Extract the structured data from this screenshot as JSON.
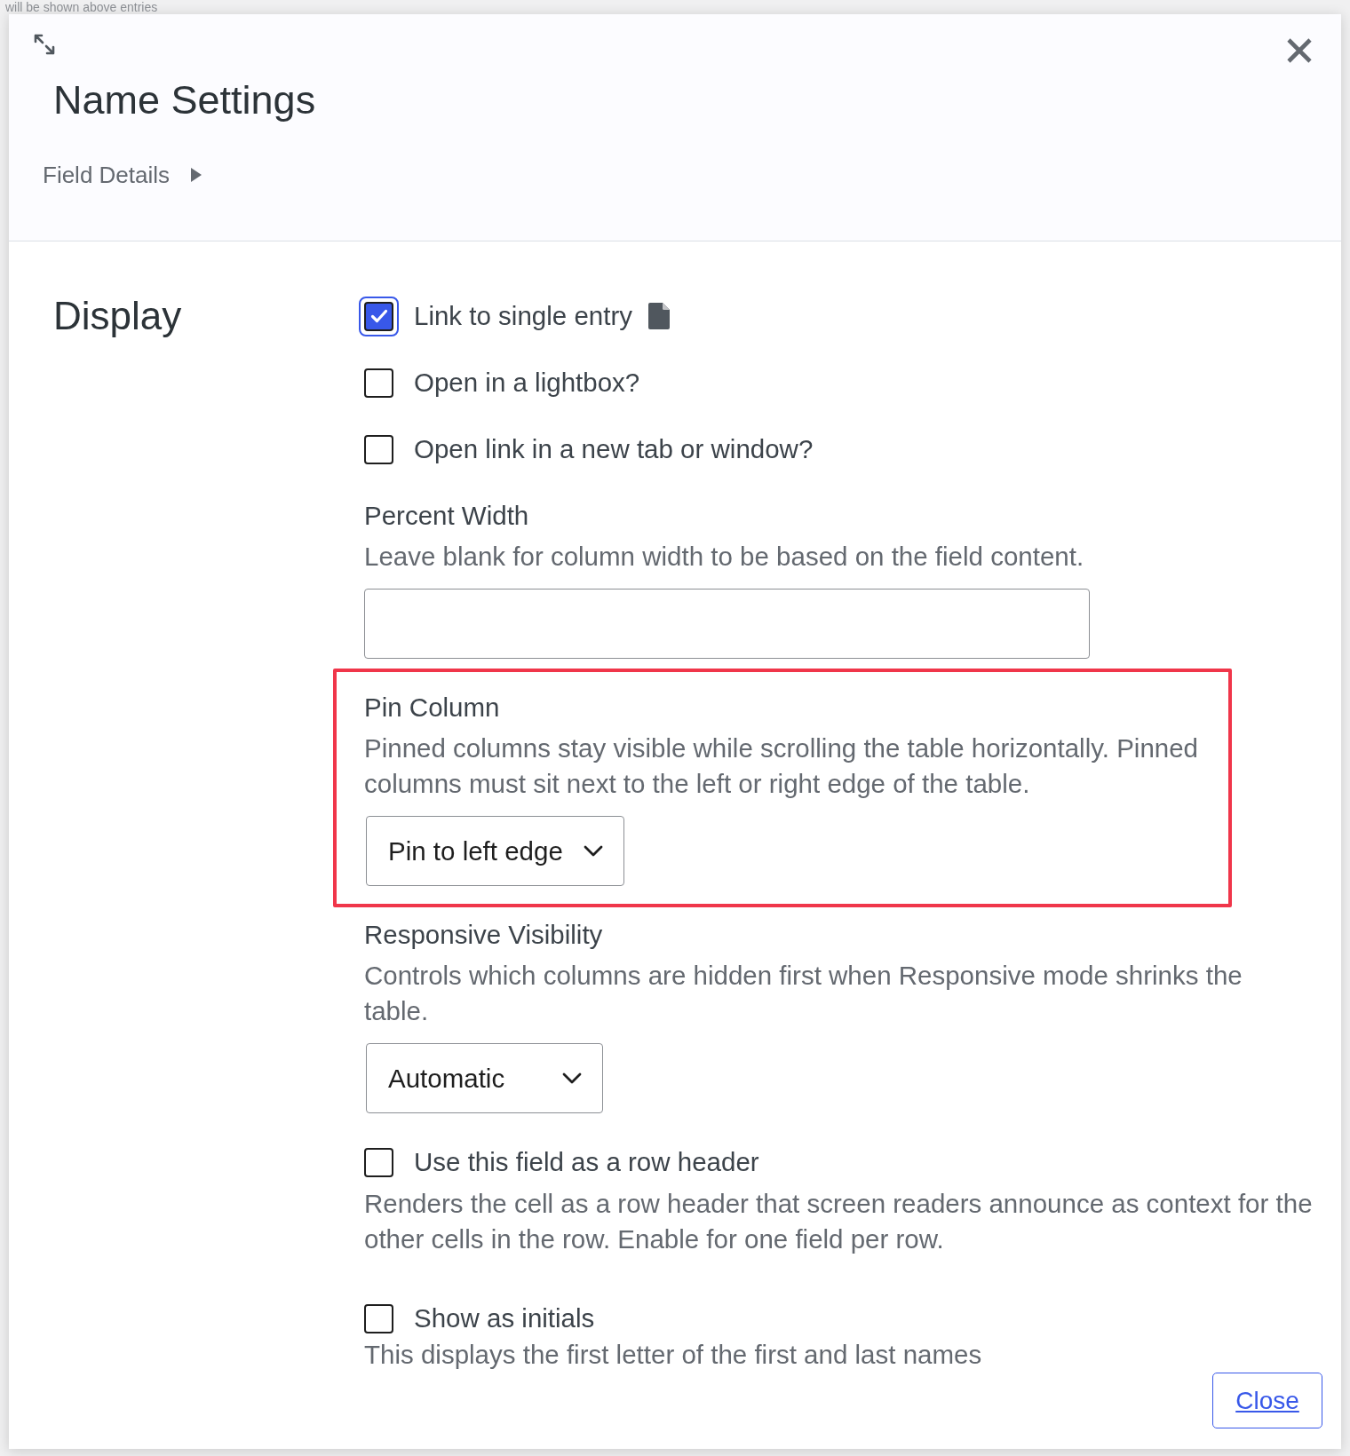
{
  "backdrop": {
    "text": "will be shown above entries"
  },
  "dialog": {
    "title": "Name Settings",
    "details_toggle": {
      "label": "Field Details",
      "expanded": false
    },
    "section": {
      "heading": "Display",
      "fields": [
        {
          "kind": "checkbox",
          "label": "Link to single entry",
          "checked": true,
          "focused": true,
          "doc_icon": true,
          "highlighted": false
        },
        {
          "kind": "checkbox",
          "label": "Open in a lightbox?",
          "checked": false,
          "focused": false,
          "doc_icon": false,
          "highlighted": false
        },
        {
          "kind": "checkbox",
          "label": "Open link in a new tab or window?",
          "checked": false,
          "focused": false,
          "doc_icon": false,
          "highlighted": false
        },
        {
          "kind": "text_input",
          "label": "Percent Width",
          "description": [
            "Leave blank for column width to be based on the field content."
          ],
          "highlighted": false
        },
        {
          "kind": "select",
          "label": "Pin Column",
          "description": [
            "Pinned columns stay visible while scrolling the table horizontally. Pinned",
            "columns must sit next to the left or right edge of the table."
          ],
          "value": "Pin to left edge",
          "highlighted": true
        },
        {
          "kind": "select",
          "label": "Responsive Visibility",
          "description": [
            "Controls which columns are hidden first when Responsive mode shrinks the",
            "table."
          ],
          "value": "Automatic",
          "highlighted": false
        },
        {
          "kind": "checkbox",
          "label": "Use this field as a row header",
          "description": [
            "Renders the cell as a row header that screen readers announce as context for the",
            "other cells in the row. Enable for one field per row."
          ],
          "checked": false,
          "focused": false,
          "doc_icon": false,
          "highlighted": false
        },
        {
          "kind": "checkbox",
          "label": "Show as initials",
          "description": [
            "This displays the first letter of the first and last names"
          ],
          "checked": false,
          "focused": false,
          "doc_icon": false,
          "highlighted": false
        }
      ]
    },
    "footer": {
      "close_button": "Close"
    }
  }
}
